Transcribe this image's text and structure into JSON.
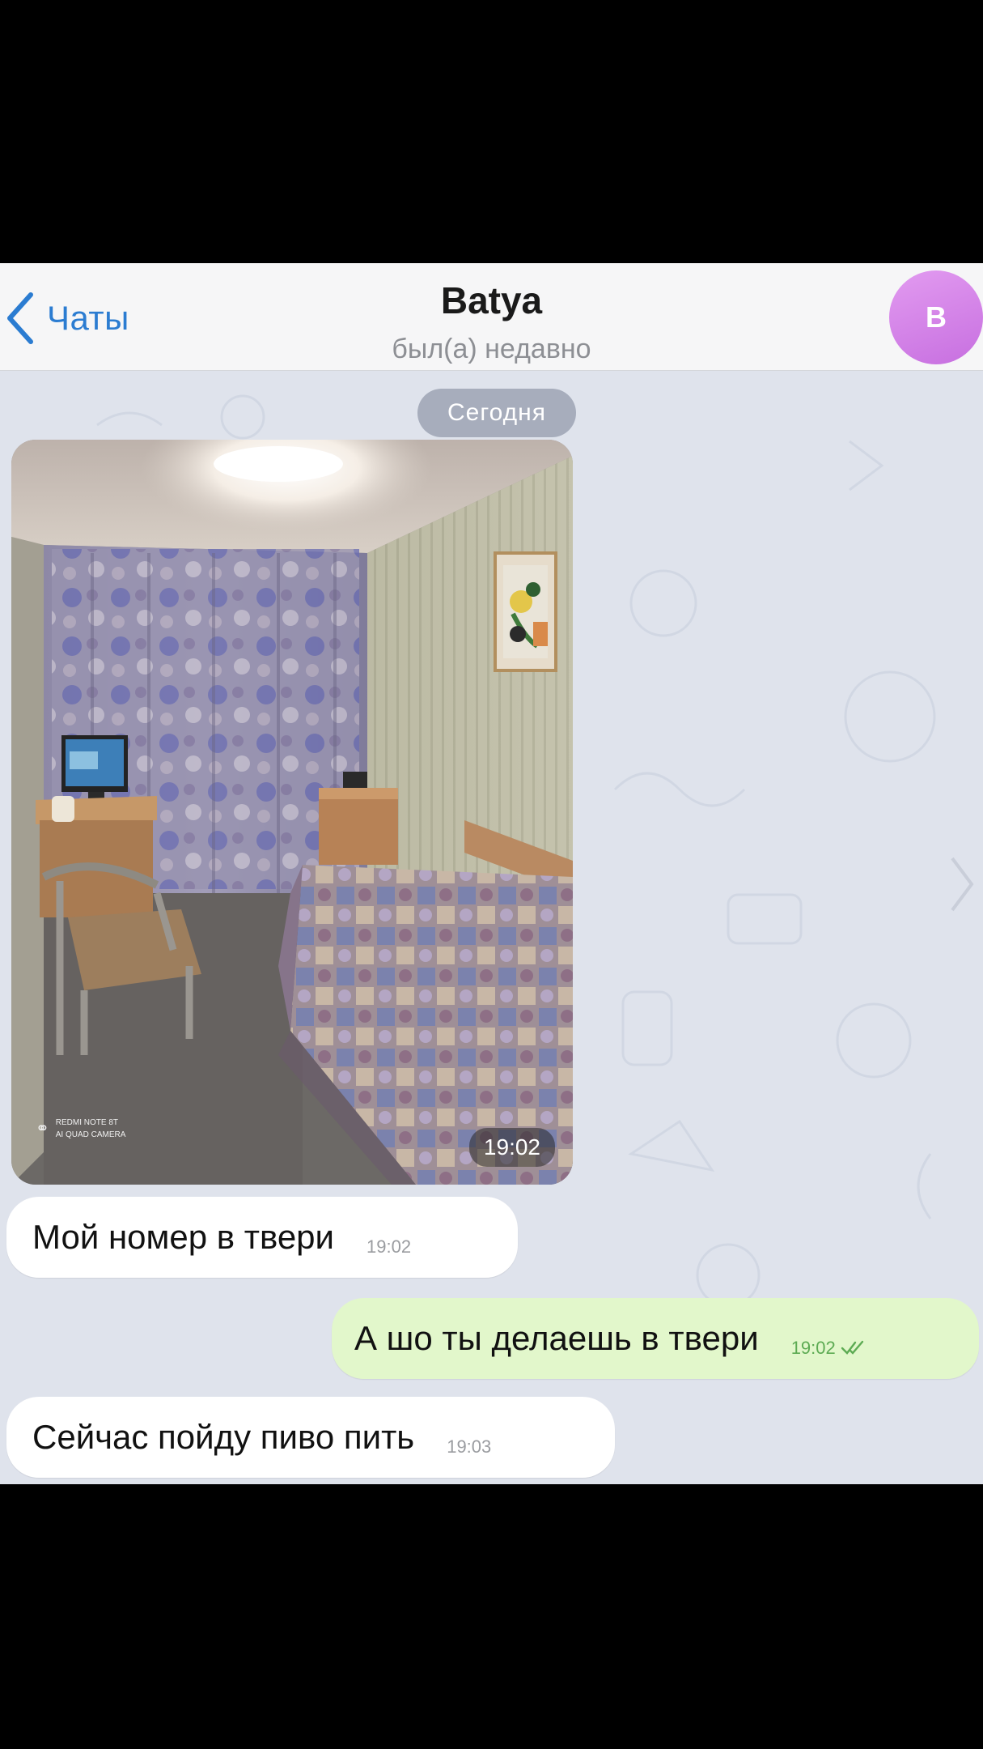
{
  "header": {
    "back_label": "Чаты",
    "title": "Batya",
    "status": "был(а) недавно",
    "avatar_letter": "B",
    "avatar_color": "#d07fe6"
  },
  "chat": {
    "date_label": "Сегодня",
    "photo": {
      "camera_line1": "REDMI NOTE 8T",
      "camera_line2": "AI QUAD CAMERA",
      "time": "19:02"
    },
    "messages": [
      {
        "direction": "in",
        "text": "Мой номер в твери",
        "time": "19:02"
      },
      {
        "direction": "out",
        "text": "А шо ты делаешь в твери",
        "time": "19:02",
        "read": true
      },
      {
        "direction": "in",
        "text": "Сейчас пойду пиво пить",
        "time": "19:03"
      }
    ]
  },
  "colors": {
    "accent": "#2b7cd1",
    "outgoing_bubble": "#e2f7cb",
    "incoming_bubble": "#ffffff",
    "chat_background": "#dfe3ec"
  }
}
